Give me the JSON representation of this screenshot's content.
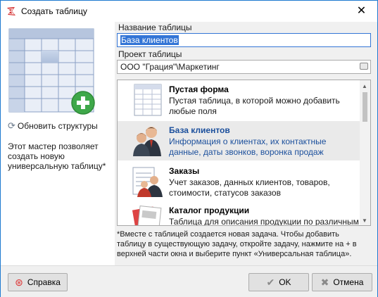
{
  "window": {
    "title": "Создать таблицу",
    "close_glyph": "✕",
    "app_icon": "app-logo-icon"
  },
  "left": {
    "refresh_label": "Обновить структуры",
    "refresh_icon": "refresh-icon",
    "description": "Этот мастер позволяет создать новую универсальную таблицу*"
  },
  "form": {
    "name_label": "Название таблицы",
    "name_value": "База клиентов",
    "project_label": "Проект таблицы",
    "project_value": "ООО \"Грация\"\\Маркетинг"
  },
  "templates": [
    {
      "name": "Пустая форма",
      "description": "Пустая таблица, в которой можно добавить любые поля",
      "icon": "blank-form-icon",
      "selected": false
    },
    {
      "name": "База клиентов",
      "description": "Информация о клиентах, их контактные данные, даты звонков, воронка продаж",
      "icon": "clients-icon",
      "selected": true
    },
    {
      "name": "Заказы",
      "description": "Учет заказов, данных клиентов, товаров, стоимости, статусов заказов",
      "icon": "orders-icon",
      "selected": false
    },
    {
      "name": "Каталог продукции",
      "description": "Таблица для описания продукции по различным",
      "icon": "catalog-icon",
      "selected": false
    }
  ],
  "note": "*Вместе с таблицей создается новая задача. Чтобы добавить таблицу в существующую задачу, откройте задачу, нажмите на + в верхней части окна и выберите пункт «Универсальная таблица».",
  "buttons": {
    "help": "Справка",
    "ok": "OK",
    "cancel": "Отмена"
  },
  "colors": {
    "accent": "#3375d6",
    "selected_text": "#1b4f9c",
    "add_badge": "#3ea84a"
  }
}
